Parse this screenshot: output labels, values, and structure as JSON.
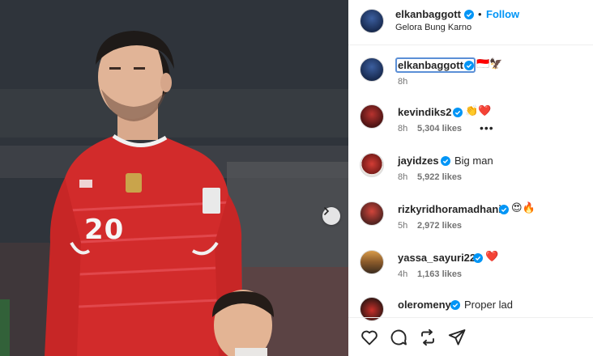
{
  "post": {
    "author": "elkanbaggott",
    "location": "Gelora Bung Karno",
    "follow_label": "Follow",
    "separator": "•",
    "caption_emoji": "🇮🇩🦅",
    "caption_time": "8h",
    "jersey_number": "20"
  },
  "comments": [
    {
      "user": "kevindiks2",
      "text": "",
      "emoji": "👏❤️",
      "time": "8h",
      "likes": "5,304 likes",
      "more": "•••"
    },
    {
      "user": "jayidzes",
      "text": "Big man",
      "emoji": "",
      "time": "8h",
      "likes": "5,922 likes"
    },
    {
      "user": "rizkyridhoramadhani",
      "text": "",
      "emoji": "😍🔥",
      "time": "5h",
      "likes": "2,972 likes"
    },
    {
      "user": "yassa_sayuri22",
      "text": "",
      "emoji": "❤️",
      "time": "4h",
      "likes": "1,163 likes"
    },
    {
      "user": "oleromeny",
      "text": "Proper lad",
      "emoji": "",
      "time": "",
      "likes": ""
    }
  ],
  "icons": {
    "verified": "verified-badge-icon",
    "next": "chevron-right-icon",
    "like": "heart-icon",
    "comment": "speech-bubble-icon",
    "share_repost": "repost-icon",
    "send": "paper-plane-icon"
  },
  "colors": {
    "follow_blue": "#0095f6",
    "verified_blue": "#0095f6",
    "jersey_red": "#d22b2b"
  }
}
